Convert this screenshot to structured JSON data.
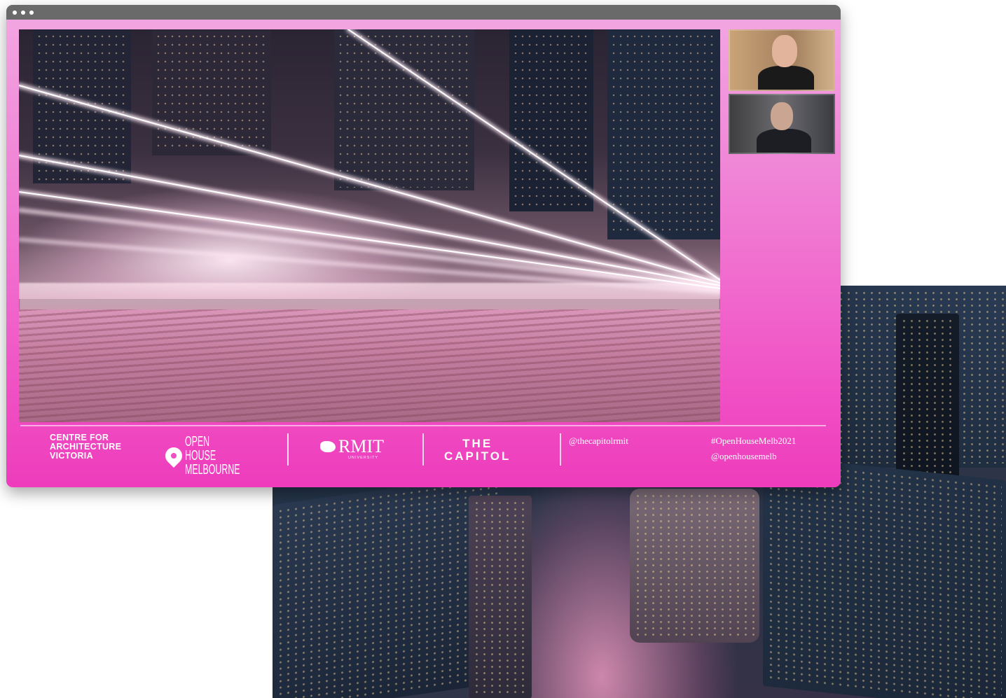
{
  "window": {
    "titlebar_dots": [
      "dot-1",
      "dot-2",
      "dot-3"
    ],
    "accent_color": "#f050c4",
    "titlebar_color": "#6a6a6a"
  },
  "stage": {
    "description_icon": "vertical-farm-render"
  },
  "participants": [
    {
      "id": "participant-1"
    },
    {
      "id": "participant-2"
    }
  ],
  "footer": {
    "cav_text": "CENTRE FOR\nARCHITECTURE\nVICTORIA",
    "ohm_text": "OPEN HOUSE\nMELBOURNE",
    "rmit_text": "RMIT",
    "rmit_sub": "UNIVERSITY",
    "capitol_text": "THE\nCAPITOL",
    "handle_capitol": "@thecapitolrmit",
    "hashtag": "#OpenHouseMelb2021",
    "handle_ohm": "@openhousemelb"
  }
}
